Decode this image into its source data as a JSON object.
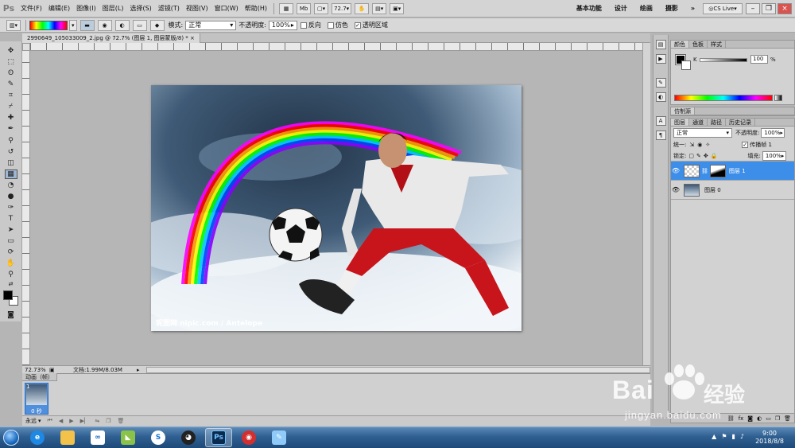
{
  "menubar": {
    "logo": "Ps",
    "items": [
      "文件(F)",
      "编辑(E)",
      "图像(I)",
      "图层(L)",
      "选择(S)",
      "滤镜(T)",
      "视图(V)",
      "窗口(W)",
      "帮助(H)"
    ],
    "mini_btn_mb": "Mb",
    "zoom": "72.7",
    "workspaces": [
      "基本功能",
      "设计",
      "绘画",
      "摄影"
    ],
    "more": "»",
    "cslive": "CS Live"
  },
  "options": {
    "mode_label": "模式:",
    "mode_value": "正常",
    "opacity_label": "不透明度:",
    "opacity_value": "100%",
    "reverse": "反向",
    "dither": "仿色",
    "transparency": "透明区域"
  },
  "document": {
    "tab_title": "2990649_105033009_2.jpg @ 72.7% (图层 1, 图层蒙版/8) *",
    "close": "×",
    "watermark_text": "昵图网 nipic.com / Antelope"
  },
  "status": {
    "zoom": "72.73%",
    "doc_info": "文档:1.99M/8.03M"
  },
  "animation": {
    "tab": "动画（帧）",
    "frame_number": "1",
    "frame_time": "0 秒",
    "loop": "永远"
  },
  "color_panel": {
    "tabs": [
      "颜色",
      "色板",
      "样式"
    ],
    "channel": "K",
    "value": "100",
    "unit": "%"
  },
  "clone_tab": "仿制源",
  "layers_panel": {
    "tabs": [
      "图层",
      "通道",
      "路径",
      "历史记录"
    ],
    "blend": "正常",
    "opacity_label": "不透明度:",
    "opacity_value": "100%",
    "unify_label": "统一:",
    "propagate": "传播帧 1",
    "lock_label": "锁定:",
    "fill_label": "填充:",
    "fill_value": "100%",
    "layers": [
      {
        "name": "图层 1",
        "selected": true
      },
      {
        "name": "图层 0",
        "selected": false
      }
    ]
  },
  "taskbar": {
    "time": "9:00",
    "date": "2018/8/8",
    "ps_label": "Ps"
  },
  "overlay": {
    "brand": "Bai",
    "brand2": "经验",
    "url": "jingyan.baidu.com"
  },
  "colors": {
    "accent": "#3d8ee8",
    "ui_gray": "#d2d2d2",
    "taskbar": "#2f5f91"
  }
}
